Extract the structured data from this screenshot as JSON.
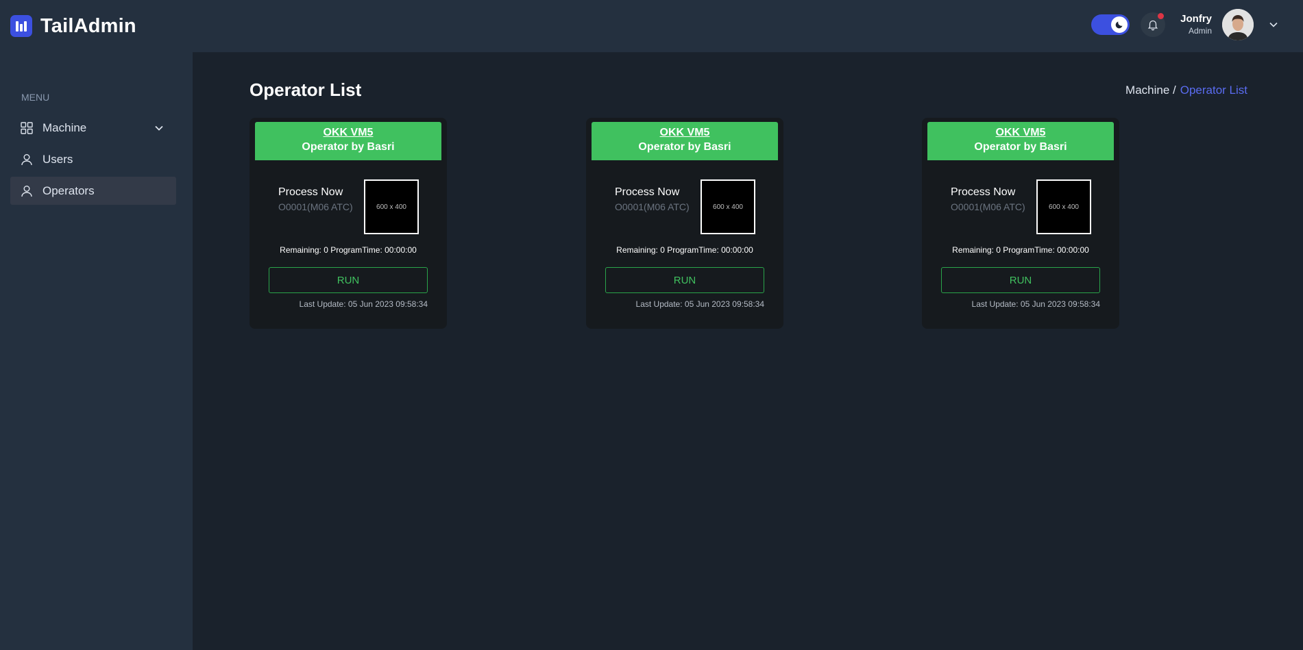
{
  "app": {
    "brand": "TailAdmin"
  },
  "sidebar": {
    "menu_heading": "MENU",
    "items": [
      {
        "label": "Machine",
        "icon": "grid-icon",
        "has_submenu": true
      },
      {
        "label": "Users",
        "icon": "user-icon"
      },
      {
        "label": "Operators",
        "icon": "user-icon",
        "active": true
      }
    ]
  },
  "header": {
    "user_name": "Jonfry",
    "user_role": "Admin",
    "dark_mode": true,
    "has_notification": true
  },
  "page": {
    "title": "Operator List",
    "breadcrumb": {
      "parent": "Machine /",
      "current": "Operator List"
    }
  },
  "cards": [
    {
      "machine": "OKK VM5",
      "operator": "Operator by Basri",
      "process_label": "Process Now",
      "process_code": "O0001(M06 ATC)",
      "image_placeholder": "600 x 400",
      "remaining": "Remaining: 0 ProgramTime: 00:00:00",
      "button": "RUN",
      "last_update": "Last Update: 05 Jun 2023 09:58:34"
    },
    {
      "machine": "OKK VM5",
      "operator": "Operator by Basri",
      "process_label": "Process Now",
      "process_code": "O0001(M06 ATC)",
      "image_placeholder": "600 x 400",
      "remaining": "Remaining: 0 ProgramTime: 00:00:00",
      "button": "RUN",
      "last_update": "Last Update: 05 Jun 2023 09:58:34"
    },
    {
      "machine": "OKK VM5",
      "operator": "Operator by Basri",
      "process_label": "Process Now",
      "process_code": "O0001(M06 ATC)",
      "image_placeholder": "600 x 400",
      "remaining": "Remaining: 0 ProgramTime: 00:00:00",
      "button": "RUN",
      "last_update": "Last Update: 05 Jun 2023 09:58:34"
    }
  ],
  "colors": {
    "primary": "#3c50e0",
    "status_green": "#40c15f",
    "sidebar_bg": "#24303f",
    "body_bg": "#1a222c",
    "card_bg": "#161a1e"
  }
}
